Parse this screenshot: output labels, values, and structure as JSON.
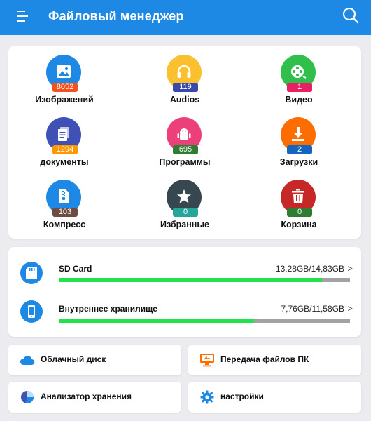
{
  "app": {
    "title": "Файловый менеджер"
  },
  "categories": [
    {
      "label": "Изображений",
      "count": "8052",
      "icon": "image-icon",
      "color": "#1e88e5",
      "badge": "#f4511e"
    },
    {
      "label": "Audios",
      "count": "119",
      "icon": "headphones-icon",
      "color": "#fbc02d",
      "badge": "#3949ab"
    },
    {
      "label": "Видео",
      "count": "1",
      "icon": "film-reel-icon",
      "color": "#2fbf4a",
      "badge": "#e91e63"
    },
    {
      "label": "документы",
      "count": "1294",
      "icon": "document-icon",
      "color": "#3f51b5",
      "badge": "#ff9800"
    },
    {
      "label": "Программы",
      "count": "695",
      "icon": "android-icon",
      "color": "#ec407a",
      "badge": "#2e7d32"
    },
    {
      "label": "Загрузки",
      "count": "2",
      "icon": "download-icon",
      "color": "#ff6d00",
      "badge": "#1565c0"
    },
    {
      "label": "Компресс",
      "count": "103",
      "icon": "archive-icon",
      "color": "#1e88e5",
      "badge": "#6d4c41"
    },
    {
      "label": "Избранные",
      "count": "0",
      "icon": "star-icon",
      "color": "#37474f",
      "badge": "#26a69a"
    },
    {
      "label": "Корзина",
      "count": "0",
      "icon": "trash-icon",
      "color": "#c62828",
      "badge": "#2e7d32"
    }
  ],
  "storage": [
    {
      "name": "SD Card",
      "size": "13,28GB/14,83GB",
      "icon": "sd-card-icon",
      "used_fraction": 0.905
    },
    {
      "name": "Внутреннее хранилище",
      "size": "7,76GB/11,58GB",
      "icon": "phone-icon",
      "used_fraction": 0.67
    }
  ],
  "tiles": [
    {
      "label": "Облачный диск",
      "icon": "cloud-icon",
      "color": "#1e88e5"
    },
    {
      "label": "Передача файлов ПК",
      "icon": "pc-transfer-icon",
      "color": "#ff6d00"
    },
    {
      "label": "Анализатор хранения",
      "icon": "pie-chart-icon",
      "color": "#3f51b5"
    },
    {
      "label": "настройки",
      "icon": "gear-icon",
      "color": "#1e88e5"
    }
  ]
}
